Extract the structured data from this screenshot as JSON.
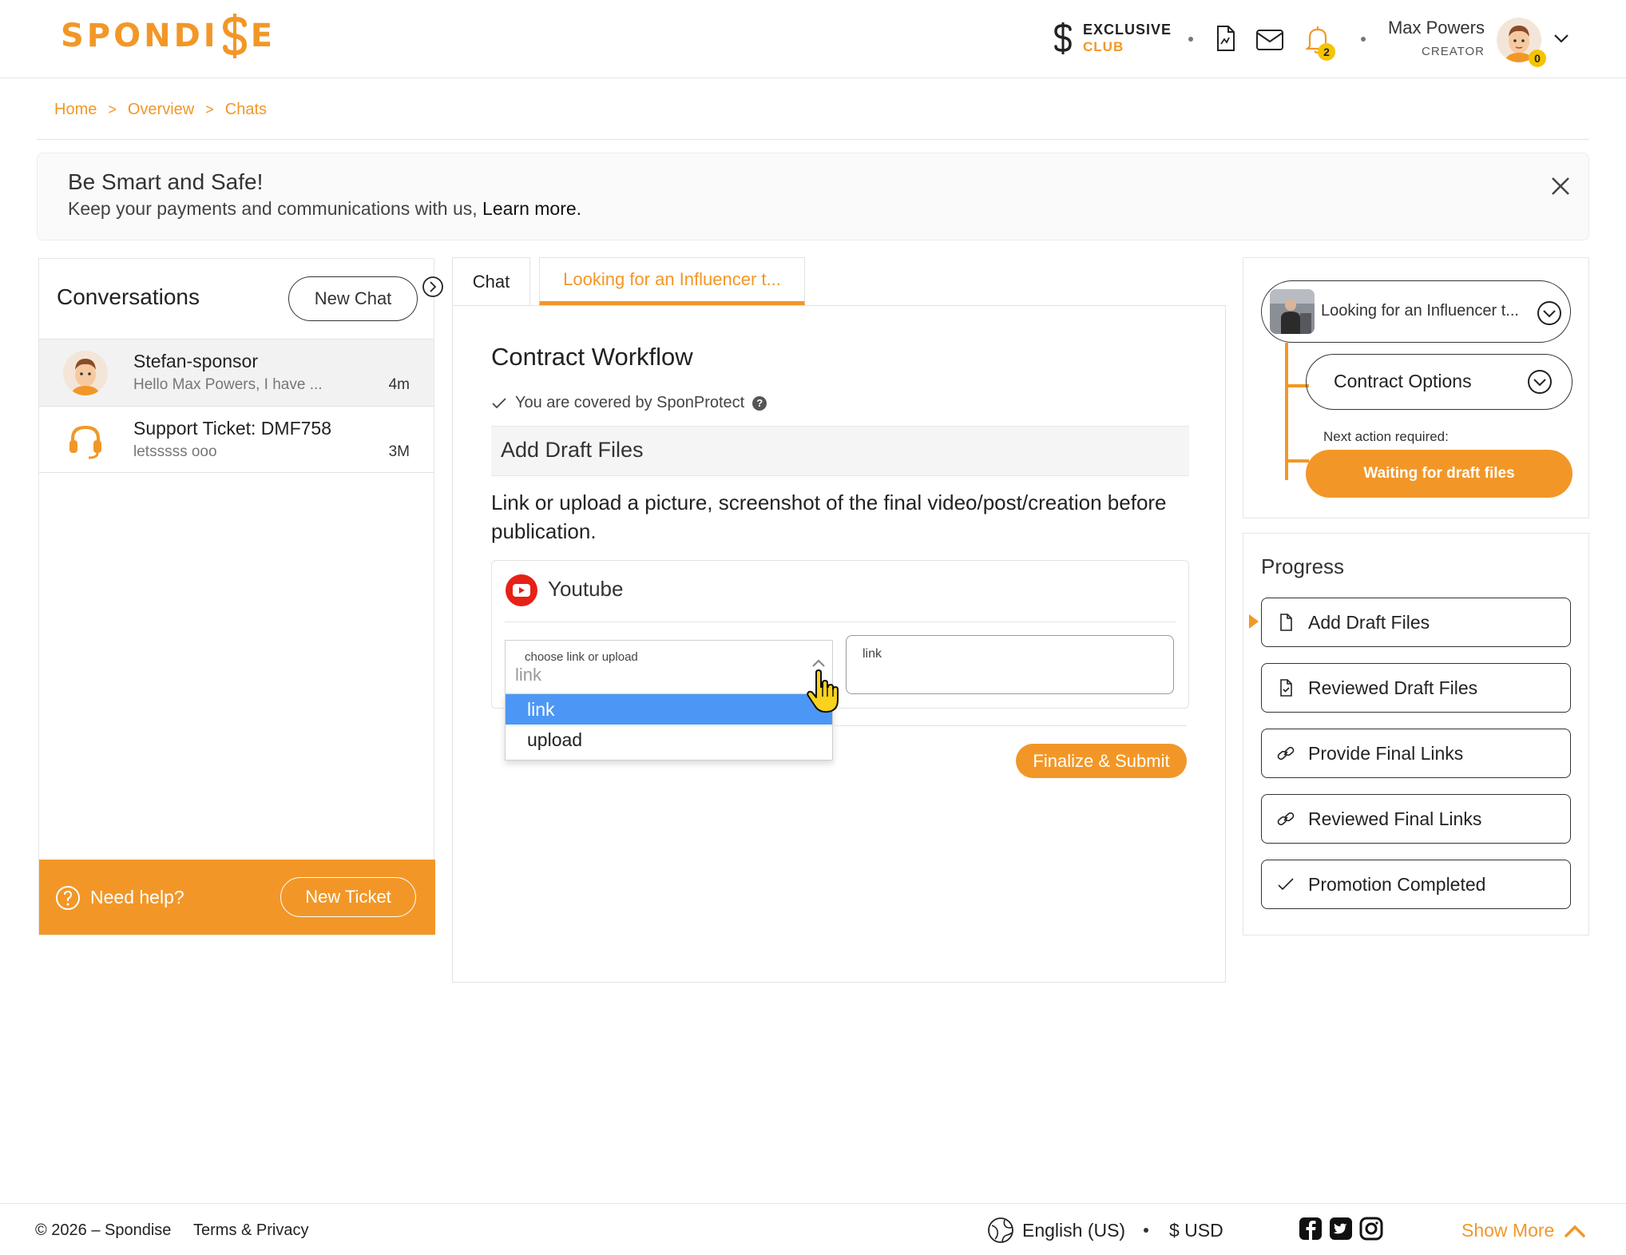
{
  "header": {
    "brand": "SPONDI$E",
    "brand_left": "SPONDI",
    "brand_right": "E",
    "exclusive_l1": "EXCLUSIVE",
    "exclusive_l2": "CLUB",
    "notification_count": "2",
    "user_name": "Max Powers",
    "user_role": "CREATOR",
    "avatar_badge": "0"
  },
  "breadcrumb": {
    "items": [
      "Home",
      "Overview",
      "Chats"
    ],
    "separator": ">"
  },
  "alert": {
    "title": "Be Smart and Safe!",
    "text": "Keep your payments and communications with us, ",
    "link": "Learn more."
  },
  "conversations": {
    "title": "Conversations",
    "new_chat": "New Chat",
    "items": [
      {
        "name": "Stefan-sponsor",
        "message": "Hello Max Powers, I have ...",
        "time": "4m"
      },
      {
        "name": "Support Ticket: DMF758",
        "message": "letsssss ooo",
        "time": "3M"
      }
    ],
    "help_text": "Need help?",
    "new_ticket": "New Ticket"
  },
  "tabs": {
    "chat": "Chat",
    "active": "Looking for an Influencer t..."
  },
  "workflow": {
    "title": "Contract Workflow",
    "covered": "You are covered by SponProtect",
    "section": "Add Draft Files",
    "instructions": "Link or upload a picture, screenshot of the final video/post/creation before publication.",
    "platform": "Youtube",
    "select_label": "choose link or upload",
    "select_value": "link",
    "options": [
      "link",
      "upload"
    ],
    "input_label": "link",
    "submit": "Finalize & Submit"
  },
  "right_panel": {
    "campaign": "Looking for an Influencer t...",
    "contract_options": "Contract Options",
    "next_action_label": "Next action required:",
    "next_action": "Waiting for draft files",
    "progress_title": "Progress",
    "steps": [
      {
        "label": "Add Draft Files",
        "icon": "file-icon"
      },
      {
        "label": "Reviewed Draft Files",
        "icon": "file-check-icon"
      },
      {
        "label": "Provide Final Links",
        "icon": "link-icon"
      },
      {
        "label": "Reviewed Final Links",
        "icon": "link-icon"
      },
      {
        "label": "Promotion Completed",
        "icon": "check-icon"
      }
    ]
  },
  "footer": {
    "copyright": "© 2026 – Spondise",
    "terms": "Terms & Privacy",
    "language": "English (US)",
    "currency": "$ USD",
    "show_more": "Show More"
  },
  "colors": {
    "accent": "#F29727",
    "selected_option": "#4C97F5",
    "badge": "#F5C400"
  }
}
